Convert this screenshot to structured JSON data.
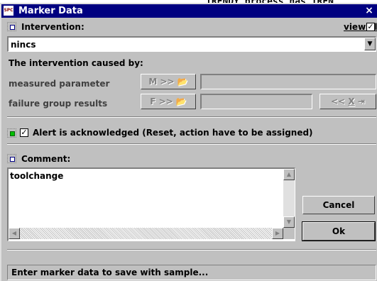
{
  "background_text": "TRENDY process has TREN",
  "window": {
    "title": "Marker Data",
    "icon": "app-icon",
    "close_glyph": "×"
  },
  "intervention": {
    "label": "Intervention:",
    "view_all_label": "view all",
    "view_all_checked": true,
    "value": "nincs"
  },
  "caused_by": {
    "heading": "The intervention caused by:",
    "measured_parameter": {
      "label": "measured parameter",
      "button": "M >>",
      "value": ""
    },
    "failure_group_results": {
      "label": "failure group results",
      "button": "F >>",
      "value": ""
    },
    "nav_buttons": [
      "<<",
      "X"
    ]
  },
  "alert": {
    "checked": true,
    "label": "Alert is acknowledged (Reset, action have to be assigned)"
  },
  "comment": {
    "label": "Comment:",
    "value": "toolchange"
  },
  "buttons": {
    "cancel": "Cancel",
    "ok": "Ok"
  },
  "status": "Enter marker data to save with sample..."
}
